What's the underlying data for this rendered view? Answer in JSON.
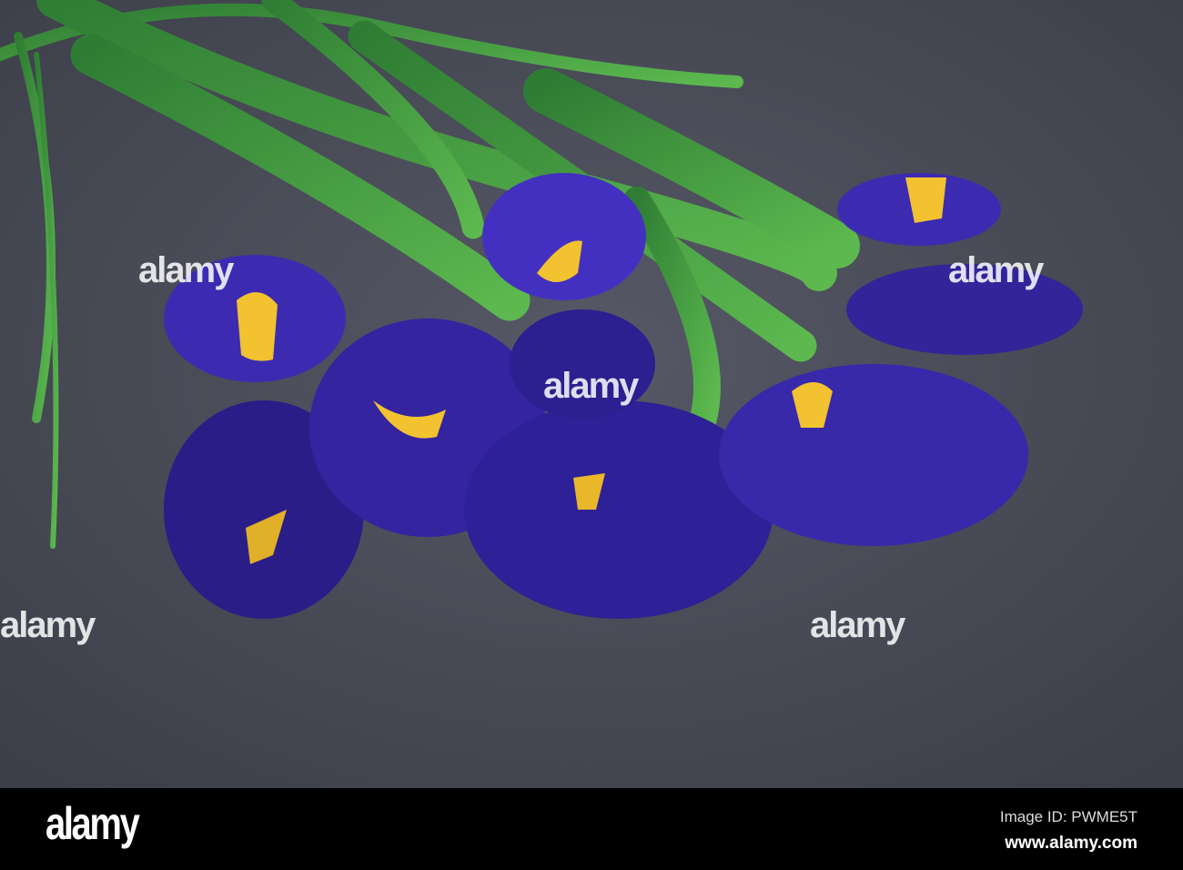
{
  "watermark": {
    "text": "alamy"
  },
  "footer": {
    "logo": "alamy",
    "image_id": "Image ID: PWME5T",
    "url": "www.alamy.com"
  },
  "colors": {
    "background": "#4a4d58",
    "petal": "#3c2bb0",
    "petal_dark": "#241a7a",
    "beard": "#f2c230",
    "leaf": "#3f9a3c"
  }
}
